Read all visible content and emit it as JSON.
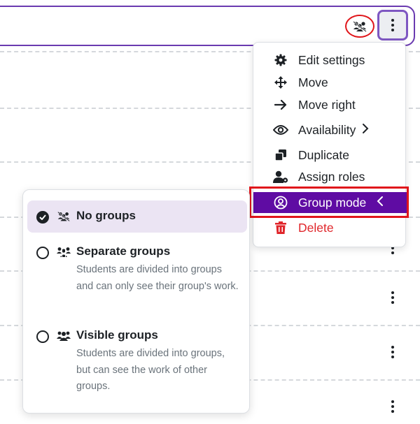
{
  "action_menu": {
    "items": [
      {
        "label": "Edit settings",
        "icon": "gear-icon"
      },
      {
        "label": "Move",
        "icon": "move-arrows-icon"
      },
      {
        "label": "Move right",
        "icon": "arrow-right-icon"
      },
      {
        "label": "Availability",
        "icon": "eye-icon"
      },
      {
        "label": "Duplicate",
        "icon": "duplicate-icon"
      },
      {
        "label": "Assign roles",
        "icon": "user-gear-icon"
      },
      {
        "label": "Group mode",
        "icon": "user-circle-icon"
      },
      {
        "label": "Delete",
        "icon": "trash-icon"
      }
    ]
  },
  "group_mode_submenu": {
    "options": [
      {
        "title": "No groups",
        "description": "",
        "selected": true,
        "icon": "no-groups-icon"
      },
      {
        "title": "Separate groups",
        "description": "Students are divided into groups and can only see their group's work.",
        "selected": false,
        "icon": "separate-groups-icon"
      },
      {
        "title": "Visible groups",
        "description": "Students are divided into groups, but can see the work of other groups.",
        "selected": false,
        "icon": "visible-groups-icon"
      }
    ]
  },
  "colors": {
    "accent_purple": "#5f0ca3",
    "highlight_red": "#e0161b",
    "delete_red": "#e0262b",
    "selected_bg": "#ebe4f3"
  }
}
